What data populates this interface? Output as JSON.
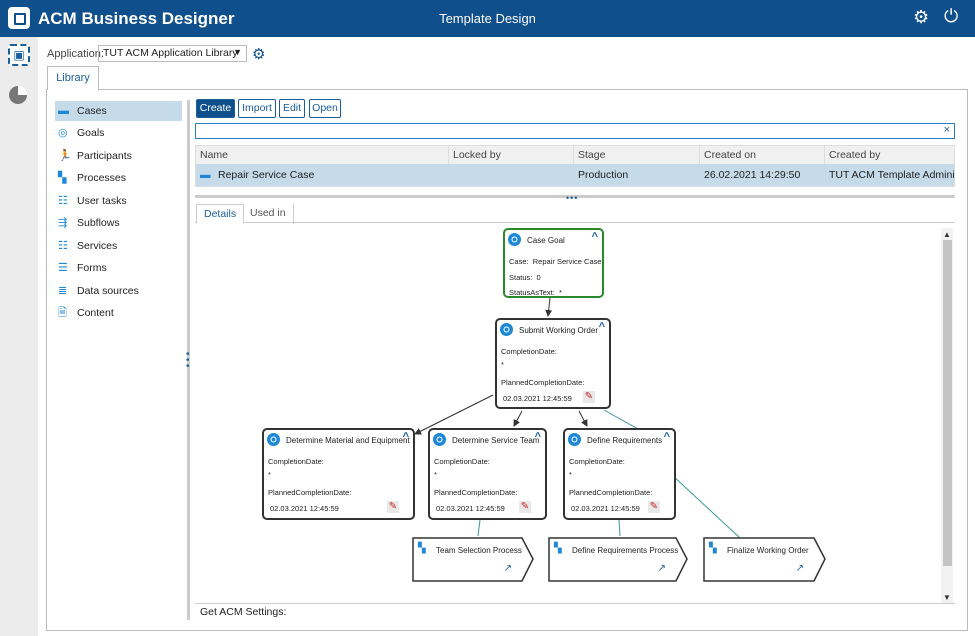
{
  "header": {
    "app_title": "ACM Business Designer",
    "page_title": "Template Design",
    "settings_icon": "gear-icon",
    "power_icon": "power-icon"
  },
  "app_selector": {
    "label": "Application:",
    "value": "TUT ACM Application Library"
  },
  "library_tab": "Library",
  "sidebar": {
    "items": [
      {
        "label": "Cases",
        "icon": "briefcase-icon",
        "selected": true
      },
      {
        "label": "Goals",
        "icon": "target-icon"
      },
      {
        "label": "Participants",
        "icon": "runner-icon"
      },
      {
        "label": "Processes",
        "icon": "process-icon"
      },
      {
        "label": "User tasks",
        "icon": "user-task-icon"
      },
      {
        "label": "Subflows",
        "icon": "subflow-icon"
      },
      {
        "label": "Services",
        "icon": "service-icon"
      },
      {
        "label": "Forms",
        "icon": "form-icon"
      },
      {
        "label": "Data sources",
        "icon": "datasource-icon"
      },
      {
        "label": "Content",
        "icon": "document-icon"
      }
    ]
  },
  "toolbar": {
    "create": "Create",
    "import": "Import",
    "edit": "Edit",
    "open": "Open"
  },
  "search": {
    "value": "",
    "clear": "×"
  },
  "table": {
    "columns": [
      "Name",
      "Locked by",
      "Stage",
      "Created on",
      "Created by"
    ],
    "rows": [
      {
        "name": "Repair Service Case",
        "locked_by": "",
        "stage": "Production",
        "created_on": "26.02.2021 14:29:50",
        "created_by": "TUT ACM Template Administ..."
      }
    ]
  },
  "detail_tabs": [
    "Details",
    "Used in"
  ],
  "diagram": {
    "case_goal": {
      "title": "Case Goal",
      "case_label": "Case:",
      "case_value": "Repair Service Case",
      "status_label": "Status:",
      "status_value": "0",
      "status_text_label": "StatusAsText:",
      "status_text_value": "*"
    },
    "goals": [
      {
        "title": "Submit Working Order",
        "completion_label": "CompletionDate:",
        "completion_value": "*",
        "planned_label": "PlannedCompletionDate:",
        "planned_value": "02.03.2021 12:45:59"
      },
      {
        "title": "Determine Material and Equipment",
        "completion_label": "CompletionDate:",
        "completion_value": "*",
        "planned_label": "PlannedCompletionDate:",
        "planned_value": "02.03.2021 12:45:59"
      },
      {
        "title": "Determine Service Team",
        "completion_label": "CompletionDate:",
        "completion_value": "*",
        "planned_label": "PlannedCompletionDate:",
        "planned_value": "02.03.2021 12:45:59"
      },
      {
        "title": "Define Requirements",
        "completion_label": "CompletionDate:",
        "completion_value": "*",
        "planned_label": "PlannedCompletionDate:",
        "planned_value": "02.03.2021 12:45:59"
      }
    ],
    "processes": [
      "Team Selection Process",
      "Define Requirements Process",
      "Finalize Working Order"
    ]
  },
  "footer": {
    "label": "Get ACM Settings:"
  }
}
